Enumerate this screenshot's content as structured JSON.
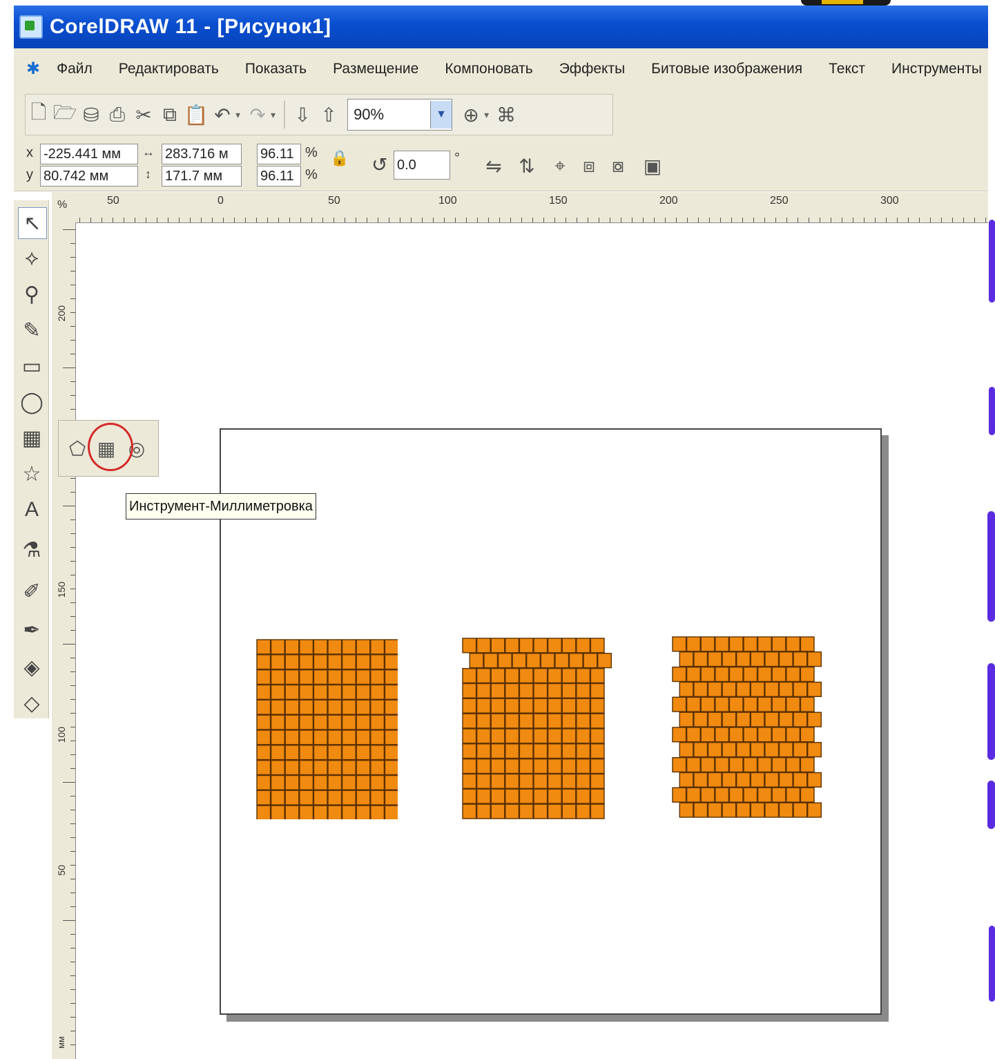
{
  "window": {
    "title": "CorelDRAW 11 - [Рисунок1]"
  },
  "menu": {
    "items": [
      "Файл",
      "Редактировать",
      "Показать",
      "Размещение",
      "Компоновать",
      "Эффекты",
      "Битовые изображения",
      "Текст",
      "Инструменты"
    ]
  },
  "toolbar": {
    "zoom_value": "90%"
  },
  "property_bar": {
    "x_label": "x",
    "y_label": "y",
    "x_value": "-225.441 мм",
    "y_value": "80.742 мм",
    "width_value": "283.716 м",
    "height_value": "171.7 мм",
    "scale_x": "96.11",
    "scale_y": "96.11",
    "percent": "%",
    "rotation_value": "0.0",
    "degree": "°"
  },
  "rulers": {
    "unit": "%",
    "top_labels": [
      "50",
      "0",
      "50",
      "100",
      "150",
      "200",
      "250",
      "300"
    ],
    "left_labels": [
      "200",
      "150",
      "100",
      "50"
    ],
    "left_unit": "мм"
  },
  "tooltip": {
    "text": "Инструмент-Миллиметровка"
  },
  "grids": [
    {
      "name": "aligned",
      "rows": 12,
      "cols": 10,
      "offset_rows": false
    },
    {
      "name": "partly-offset",
      "rows": 12,
      "cols": 10,
      "offset_rows": true
    },
    {
      "name": "brick",
      "rows": 12,
      "cols": 10,
      "offset_rows": true
    }
  ],
  "colors": {
    "cell_fill": "#f08a10",
    "cell_stroke": "#5a3000",
    "title_bar": "#0a4fd0",
    "accent_purple": "#5a2be0",
    "highlight_circle": "#d42a2a"
  }
}
